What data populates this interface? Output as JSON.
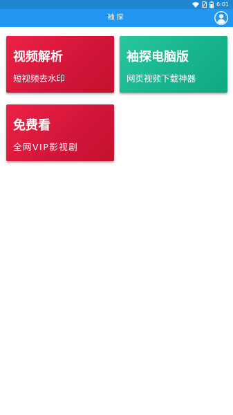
{
  "status_bar": {
    "time": "6:01",
    "icons": [
      "wifi-icon",
      "no-sim-icon",
      "battery-icon"
    ]
  },
  "app_bar": {
    "title": "袖探",
    "avatar_icon": "account-circle-icon"
  },
  "cards": [
    {
      "title": "视频解析",
      "subtitle": "短视频去水印",
      "color": "#e0193e"
    },
    {
      "title": "袖探电脑版",
      "subtitle": "网页视频下载神器",
      "color": "#1bb991"
    },
    {
      "title": "免费看",
      "subtitle": "全网VIP影视剧",
      "color": "#e0193e"
    }
  ],
  "colors": {
    "status_bar": "#1f86d3",
    "app_bar": "#2196f3",
    "background": "#ffffff"
  }
}
